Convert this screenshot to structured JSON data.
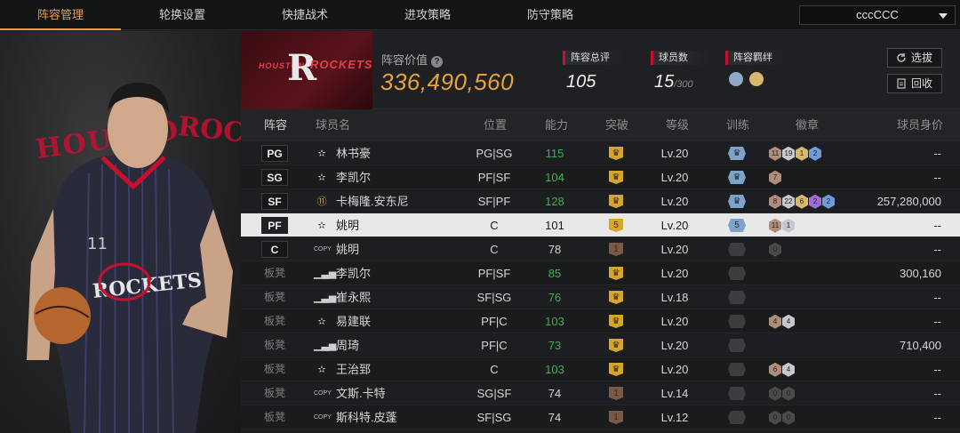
{
  "nav": {
    "tabs": [
      {
        "label": "阵容管理",
        "active": true
      },
      {
        "label": "轮换设置",
        "active": false
      },
      {
        "label": "快捷战术",
        "active": false
      },
      {
        "label": "进攻策略",
        "active": false
      },
      {
        "label": "防守策略",
        "active": false
      }
    ],
    "user_select": "cccCCC"
  },
  "portrait": {
    "bg_text_left": "HOUSTO",
    "bg_text_right": "ROCK"
  },
  "header": {
    "logo_text_left": "HOUSTON",
    "logo_text_right": "ROCKETS",
    "logo_letter": "R",
    "lineup_value_label": "阵容价值",
    "lineup_value": "336,490,560",
    "overall_label": "阵容总评",
    "overall_value": "105",
    "players_label": "球员数",
    "players_value": "15",
    "players_max": "/300",
    "bond_label": "阵容羁绊",
    "pick_button": "选拔",
    "recycle_button": "回收",
    "accent": "#e9a23b",
    "brand": "#c8102e"
  },
  "table": {
    "headers": {
      "lineup": "阵容",
      "name": "球员名",
      "position": "位置",
      "ability": "能力",
      "breakthrough": "突破",
      "level": "等级",
      "training": "训练",
      "badges": "徽章",
      "price": "球员身价"
    },
    "rows": [
      {
        "slot": "PG",
        "bench": false,
        "type": "star",
        "name": "林书豪",
        "pos": "PG|SG",
        "ability": "115",
        "green": true,
        "break": "crown",
        "level": "Lv.20",
        "train": "blue",
        "badges": [
          [
            "11",
            "#b08c7a"
          ],
          [
            "19",
            "#c7c7cf"
          ],
          [
            "1",
            "#d8b86a"
          ],
          [
            "2",
            "#6f9bd6"
          ]
        ],
        "price": "--"
      },
      {
        "slot": "SG",
        "bench": false,
        "type": "star",
        "name": "李凯尔",
        "pos": "PF|SF",
        "ability": "104",
        "green": true,
        "break": "crown",
        "level": "Lv.20",
        "train": "blue",
        "badges": [
          [
            "7",
            "#b08c7a"
          ]
        ],
        "price": "--"
      },
      {
        "slot": "SF",
        "bench": false,
        "type": "num",
        "name": "卡梅隆.安东尼",
        "pos": "SF|PF",
        "ability": "128",
        "green": true,
        "break": "crown",
        "level": "Lv.20",
        "train": "blue",
        "badges": [
          [
            "8",
            "#b08c7a"
          ],
          [
            "22",
            "#c7c7cf"
          ],
          [
            "6",
            "#d8b86a"
          ],
          [
            "2",
            "#9d6fd6"
          ],
          [
            "2",
            "#6f9bd6"
          ]
        ],
        "price": "257,280,000"
      },
      {
        "slot": "PF",
        "bench": false,
        "selected": true,
        "type": "star",
        "name": "姚明",
        "pos": "C",
        "ability": "101",
        "green": false,
        "break": "5",
        "level": "Lv.20",
        "train": "5",
        "badges": [
          [
            "11",
            "#b08c7a"
          ],
          [
            "1",
            "#c7c7cf"
          ]
        ],
        "price": "--"
      },
      {
        "slot": "C",
        "bench": false,
        "type": "copy",
        "name": "姚明",
        "pos": "C",
        "ability": "78",
        "green": false,
        "break": "1",
        "level": "Lv.20",
        "train": "none",
        "badges": [
          [
            "0",
            "#4a4a4a"
          ]
        ],
        "price": "--"
      },
      {
        "slot": "板凳",
        "bench": true,
        "type": "bars",
        "name": "李凯尔",
        "pos": "PF|SF",
        "ability": "85",
        "green": true,
        "break": "crown",
        "level": "Lv.20",
        "train": "none",
        "badges": [],
        "price": "300,160"
      },
      {
        "slot": "板凳",
        "bench": true,
        "type": "bars",
        "name": "崔永熙",
        "pos": "SF|SG",
        "ability": "76",
        "green": true,
        "break": "crown",
        "level": "Lv.18",
        "train": "none",
        "badges": [],
        "price": "--"
      },
      {
        "slot": "板凳",
        "bench": true,
        "type": "star",
        "name": "易建联",
        "pos": "PF|C",
        "ability": "103",
        "green": true,
        "break": "crown",
        "level": "Lv.20",
        "train": "none",
        "badges": [
          [
            "4",
            "#b08c7a"
          ],
          [
            "4",
            "#c7c7cf"
          ]
        ],
        "price": "--"
      },
      {
        "slot": "板凳",
        "bench": true,
        "type": "bars",
        "name": "周琦",
        "pos": "PF|C",
        "ability": "73",
        "green": true,
        "break": "crown",
        "level": "Lv.20",
        "train": "none",
        "badges": [],
        "price": "710,400"
      },
      {
        "slot": "板凳",
        "bench": true,
        "type": "star",
        "name": "王治郅",
        "pos": "C",
        "ability": "103",
        "green": true,
        "break": "crown",
        "level": "Lv.20",
        "train": "none",
        "badges": [
          [
            "6",
            "#b08c7a"
          ],
          [
            "4",
            "#c7c7cf"
          ]
        ],
        "price": "--"
      },
      {
        "slot": "板凳",
        "bench": true,
        "type": "copy",
        "name": "文斯.卡特",
        "pos": "SG|SF",
        "ability": "74",
        "green": false,
        "break": "1",
        "level": "Lv.14",
        "train": "none",
        "badges": [
          [
            "0",
            "#4a4a4a"
          ],
          [
            "0",
            "#4a4a4a"
          ]
        ],
        "price": "--"
      },
      {
        "slot": "板凳",
        "bench": true,
        "type": "copy",
        "name": "斯科特.皮蓬",
        "pos": "SF|SG",
        "ability": "74",
        "green": false,
        "break": "1",
        "level": "Lv.12",
        "train": "none",
        "badges": [
          [
            "0",
            "#4a4a4a"
          ],
          [
            "0",
            "#4a4a4a"
          ]
        ],
        "price": "--"
      }
    ]
  }
}
